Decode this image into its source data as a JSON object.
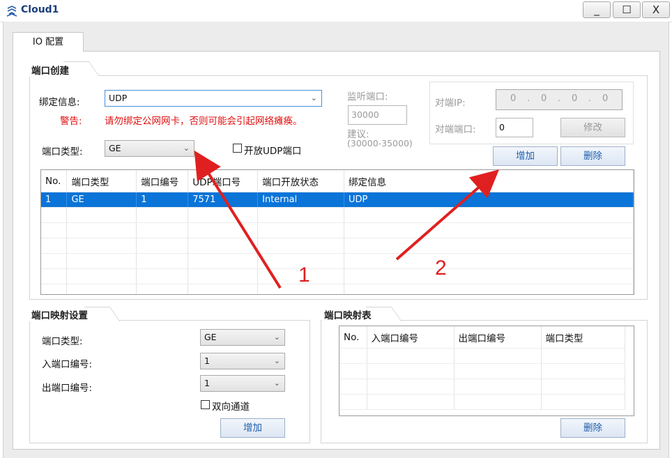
{
  "window": {
    "title": "Cloud1",
    "minimize_label": "_",
    "maximize_label": "☐",
    "close_label": "X"
  },
  "tab": {
    "label": "IO 配置"
  },
  "port_create": {
    "group_title": "端口创建",
    "bind_info_label": "绑定信息:",
    "bind_info_value": "UDP",
    "warning_label": "警告:",
    "warning_text": "请勿绑定公网网卡，否则可能会引起网络瘫痪。",
    "port_type_label": "端口类型:",
    "port_type_value": "GE",
    "open_udp_label": "开放UDP端口",
    "listen_port_label": "监听端口:",
    "listen_port_value": "30000",
    "suggest_label": "建议:",
    "suggest_range": "(30000-35000)",
    "peer_ip_label": "对端IP:",
    "peer_ip_value": [
      "0",
      "0",
      "0",
      "0"
    ],
    "peer_port_label": "对端端口:",
    "peer_port_value": "0",
    "modify_button": "修改",
    "add_button": "增加",
    "delete_button": "删除",
    "table": {
      "headers": [
        "No.",
        "端口类型",
        "端口编号",
        "UDP端口号",
        "端口开放状态",
        "绑定信息"
      ],
      "rows": [
        [
          "1",
          "GE",
          "1",
          "7571",
          "Internal",
          "UDP"
        ]
      ]
    }
  },
  "port_map_settings": {
    "group_title": "端口映射设置",
    "port_type_label": "端口类型:",
    "port_type_value": "GE",
    "in_port_label": "入端口编号:",
    "in_port_value": "1",
    "out_port_label": "出端口编号:",
    "out_port_value": "1",
    "bidirectional_label": "双向通道",
    "add_button": "增加"
  },
  "port_map_table": {
    "group_title": "端口映射表",
    "headers": [
      "No.",
      "入端口编号",
      "出端口编号",
      "端口类型"
    ],
    "delete_button": "删除"
  },
  "annotations": {
    "label_1": "1",
    "label_2": "2",
    "arrow_color": "#e02020"
  },
  "colors": {
    "selection": "#0a74d8",
    "warning": "#e01010",
    "button_text": "#2060b0"
  }
}
